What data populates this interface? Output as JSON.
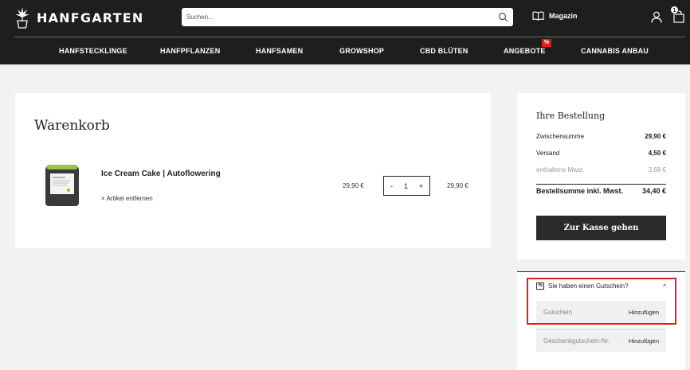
{
  "header": {
    "logo_text": "HANFGARTEN",
    "search_placeholder": "Suchen...",
    "magazin_label": "Magazin",
    "cart_count": "1"
  },
  "nav": {
    "items": [
      {
        "label": "HANFSTECKLINGE"
      },
      {
        "label": "HANFPFLANZEN"
      },
      {
        "label": "HANFSAMEN"
      },
      {
        "label": "GROWSHOP"
      },
      {
        "label": "CBD BLÜTEN"
      },
      {
        "label": "ANGEBOTE"
      },
      {
        "label": "CANNABIS ANBAU"
      }
    ],
    "offer_badge": "%"
  },
  "cart": {
    "title": "Warenkorb",
    "items": [
      {
        "name": "Ice Cream Cake | Autoflowering",
        "remove_label": "× Artikel entfernen",
        "unit_price": "29,90 €",
        "qty_minus": "-",
        "quantity": "1",
        "qty_plus": "+",
        "total_price": "29,90 €"
      }
    ]
  },
  "summary": {
    "title": "Ihre Bestellung",
    "subtotal_label": "Zwischensumme",
    "subtotal_value": "29,90 €",
    "shipping_label": "Versand",
    "shipping_value": "4,50 €",
    "tax_label": "enthaltene Mwst.",
    "tax_value": "2,68 €",
    "total_label": "Bestellsumme inkl. Mwst.",
    "total_value": "34,40 €",
    "checkout_label": "Zur Kasse gehen"
  },
  "coupon": {
    "icon_text": "%",
    "heading": "Sie haben einen Gutschein?",
    "chevron": "^",
    "voucher_placeholder": "Gutschein",
    "voucher_add": "Hinzufügen",
    "gift_placeholder": "Geschenkgutschein-Nr.",
    "gift_add": "Hinzufügen"
  },
  "colors": {
    "header_bg": "#1e1e1e",
    "accent_red": "#e01b24",
    "button_bg": "#2a2a2a"
  }
}
